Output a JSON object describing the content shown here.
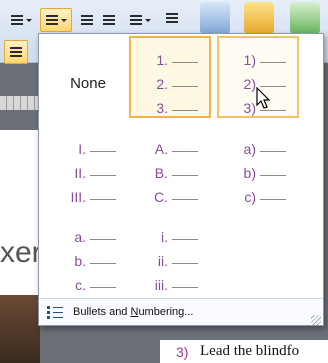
{
  "toolbar": {
    "buttons": [
      {
        "name": "bullets-button",
        "icon": "bulleted-list-icon"
      },
      {
        "name": "numbering-button",
        "icon": "numbered-list-icon",
        "active": true
      },
      {
        "name": "decrease-indent-button",
        "icon": "decrease-indent-icon"
      },
      {
        "name": "increase-indent-button",
        "icon": "increase-indent-icon"
      },
      {
        "name": "line-spacing-button",
        "icon": "line-spacing-icon"
      },
      {
        "name": "text-direction-button",
        "icon": "text-direction-icon"
      }
    ]
  },
  "numbering_gallery": {
    "none_label": "None",
    "tiles": [
      {
        "id": "none",
        "type": "none"
      },
      {
        "id": "numbers-period",
        "markers": [
          "1.",
          "2.",
          "3."
        ],
        "state": "selected"
      },
      {
        "id": "numbers-paren",
        "markers": [
          "1)",
          "2)",
          "3)"
        ],
        "state": "hover"
      },
      {
        "id": "roman-upper",
        "markers": [
          "I.",
          "II.",
          "III."
        ]
      },
      {
        "id": "alpha-upper",
        "markers": [
          "A.",
          "B.",
          "C."
        ]
      },
      {
        "id": "alpha-lower-paren",
        "markers": [
          "a)",
          "b)",
          "c)"
        ]
      },
      {
        "id": "alpha-lower-period",
        "markers": [
          "a.",
          "b.",
          "c."
        ]
      },
      {
        "id": "roman-lower",
        "markers": [
          "i.",
          "ii.",
          "iii."
        ]
      }
    ],
    "footer_label": "Bullets and Numbering...",
    "footer_underline_char": "N",
    "footer_icon": "bullets-numbering-icon"
  },
  "document": {
    "slide_text_fragment": "xer",
    "list_item_number": "3)",
    "list_item_text": "Lead the blindfo"
  },
  "colors": {
    "accent_border": "#f0b44a",
    "marker_color": "#8a4b9a"
  }
}
